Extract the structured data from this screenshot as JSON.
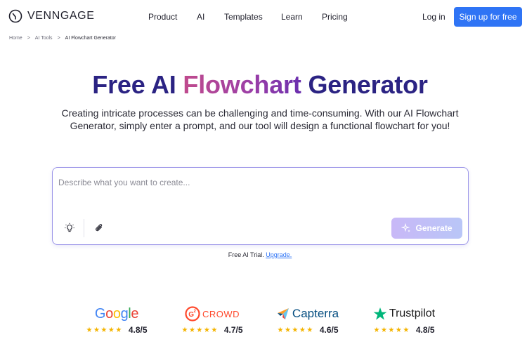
{
  "nav": {
    "brand": "VENNGAGE",
    "links": [
      "Product",
      "AI",
      "Templates",
      "Learn",
      "Pricing"
    ],
    "login": "Log in",
    "signup": "Sign up for free"
  },
  "breadcrumb": {
    "items": [
      "Home",
      "AI Tools",
      "AI Flowchart Generator"
    ],
    "separator": ">"
  },
  "hero": {
    "title_part1": "Free AI ",
    "title_accent": "Flowchart",
    "title_part2": " Generator",
    "subtitle": "Creating intricate processes can be challenging and time-consuming. With our AI Flowchart Generator, simply enter a prompt, and our tool will design a functional flowchart for you!"
  },
  "prompt": {
    "value": "",
    "placeholder": "Describe what you want to create...",
    "generate_label": "Generate",
    "icons": [
      "lightbulb-icon",
      "paperclip-icon",
      "sparkle-icon"
    ]
  },
  "trial": {
    "text": "Free AI Trial.",
    "link": "Upgrade."
  },
  "ratings": [
    {
      "brand": "Google",
      "score": "4.8/5",
      "stars": 4.5
    },
    {
      "brand": "CROWD",
      "score": "4.7/5",
      "stars": 4.5
    },
    {
      "brand": "Capterra",
      "score": "4.6/5",
      "stars": 4.5
    },
    {
      "brand": "Trustpilot",
      "score": "4.8/5",
      "stars": 4.5
    }
  ],
  "colors": {
    "primary_blue": "#2f74f5",
    "title_navy": "#2b2383",
    "accent_magenta": "#c04b8d",
    "prompt_border": "#9a94e8",
    "star_gold": "#f4b400"
  }
}
